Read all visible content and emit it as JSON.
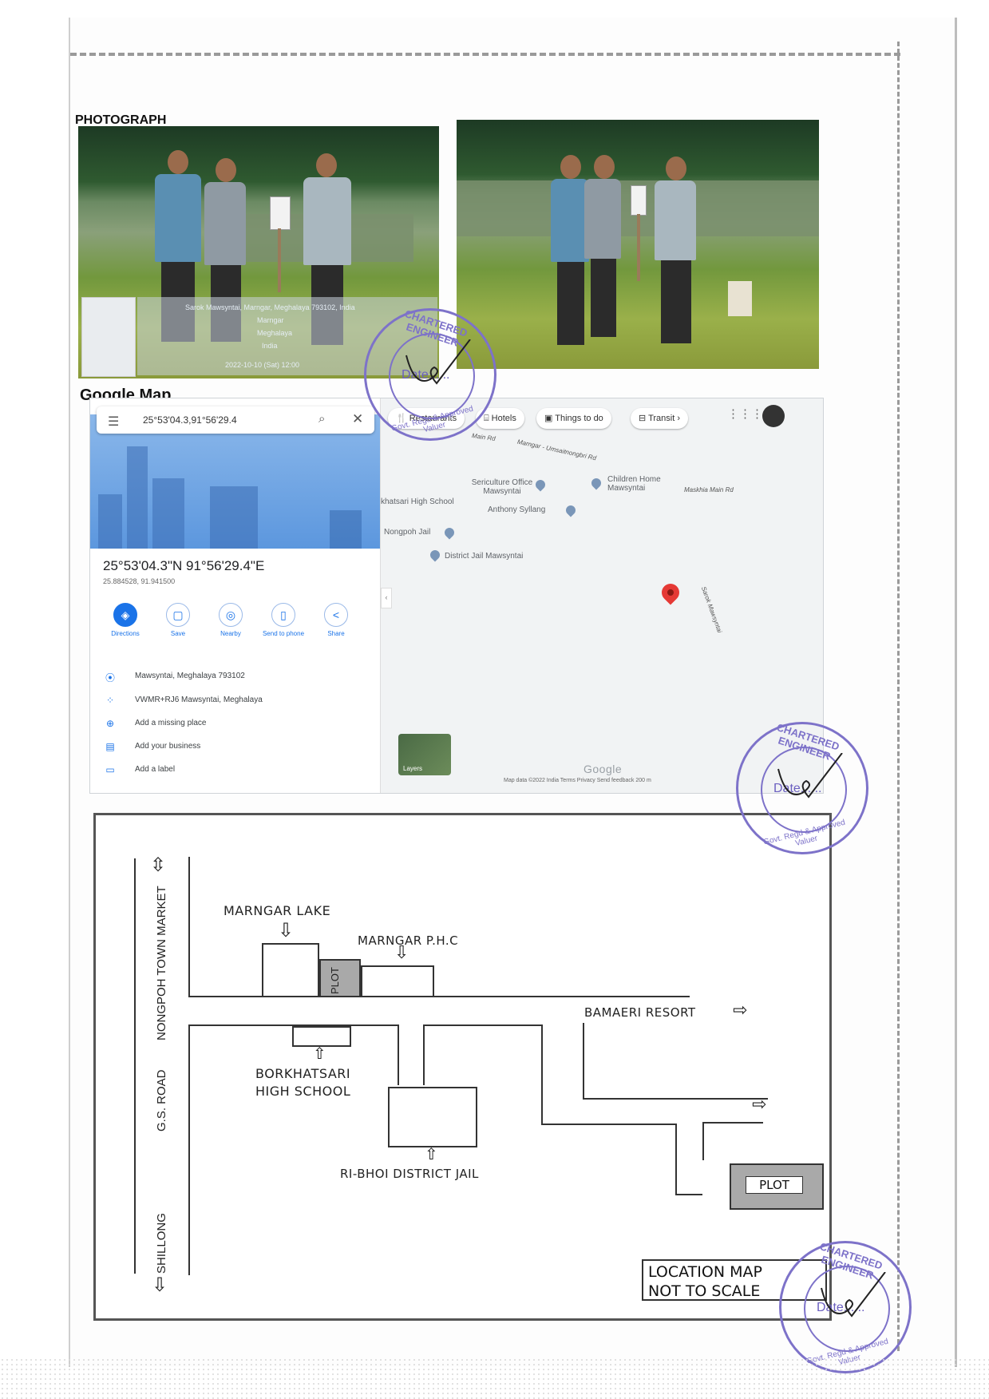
{
  "headings": {
    "photograph": "PHOTOGRAPH",
    "google_map": "Google Map"
  },
  "photo_overlay": {
    "lines": [
      "Sarok Mawsyntai, Marngar, Meghalaya 793102, India",
      "Marngar",
      "Meghalaya",
      "India",
      "2022-10-10 (Sat) 12:00"
    ]
  },
  "gmap": {
    "search_value": "25°53'04.3,91°56'29.4",
    "coordinates": "25°53'04.3\"N 91°56'29.4\"E",
    "decimal": "25.884528, 91.941500",
    "actions": [
      "Directions",
      "Save",
      "Nearby",
      "Send to phone",
      "Share"
    ],
    "info": [
      {
        "icon": "location-pin-icon",
        "text": "Mawsyntai, Meghalaya 793102"
      },
      {
        "icon": "plus-code-icon",
        "text": "VWMR+RJ6 Mawsyntai, Meghalaya"
      },
      {
        "icon": "add-place-icon",
        "text": "Add a missing place"
      },
      {
        "icon": "business-icon",
        "text": "Add your business"
      },
      {
        "icon": "label-icon",
        "text": "Add a label"
      }
    ],
    "chips": [
      "Restaurants",
      "Hotels",
      "Things to do",
      "Transit"
    ],
    "places": {
      "sericulture": "Sericulture Office Mawsyntai",
      "children_home": "Children Home Mawsyntai",
      "borkhatsari": "khatsari High School",
      "anthony": "Anthony Syllang",
      "nongpoh_jail": "Nongpoh Jail",
      "district_jail": "District Jail Mawsyntai"
    },
    "roads": {
      "main_rd": "Main Rd",
      "marngar": "Marngar - Umsaitnongbri Rd",
      "maskhia": "Maskhia Main Rd",
      "sarok": "Sarok Mawsyntai"
    },
    "layers": "Layers",
    "google": "Google",
    "attribution": "Map data ©2022   India   Terms   Privacy   Send feedback   200 m"
  },
  "location_map": {
    "nongpoh": "NONGPOH TOWN MARKET",
    "gs_road": "G.S. ROAD",
    "shillong": "SHILLONG",
    "marngar_lake": "MARNGAR LAKE",
    "marngar_phc": "MARNGAR P.H.C",
    "plot_vertical": "PLOT",
    "bamaeri": "BAMAERI RESORT",
    "borkhatsari_1": "BORKHATSARI",
    "borkhatsari_2": "HIGH SCHOOL",
    "district_jail": "RI-BHOI DISTRICT JAIL",
    "plot": "PLOT",
    "legend_1": "LOCATION MAP",
    "legend_2": "NOT TO SCALE"
  },
  "stamps": {
    "top": "CHARTERED ENGINEER",
    "bottom": "Govt. Regd & Approved Valuer",
    "date": "Date......"
  },
  "colors": {
    "stamp": "#7d72c9",
    "map_pin": "#e53935",
    "google_blue": "#1a73e8"
  }
}
